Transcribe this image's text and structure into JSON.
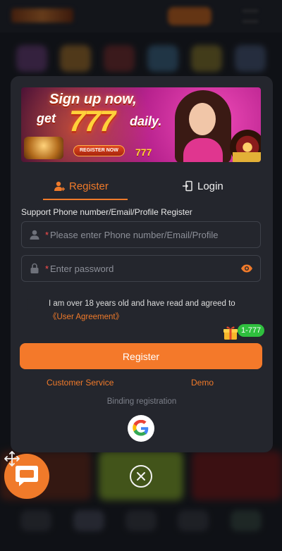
{
  "banner": {
    "line1": "Sign up now,",
    "line2_prefix": "get",
    "line2_number": "777",
    "line2_suffix": "daily.",
    "button": "REGISTER NOW",
    "slot": "777"
  },
  "tabs": {
    "register": "Register",
    "login": "Login",
    "active": "Register"
  },
  "form": {
    "support_text": "Support Phone number/Email/Profile Register",
    "required_mark": "*",
    "phone_placeholder": "Please enter Phone number/Email/Profile",
    "password_placeholder": "Enter password",
    "agree_text": "I am over 18 years old and have read and agreed to ",
    "agree_link": "《User Agreement》",
    "register_button": "Register"
  },
  "promo": {
    "tag": "1-777"
  },
  "links": {
    "customer_service": "Customer Service",
    "demo": "Demo",
    "binding": "Binding registration"
  },
  "colors": {
    "accent": "#f4792a",
    "modal_bg": "#24262d",
    "badge_green": "#2fbf3e"
  },
  "icons": {
    "register_tab": "add-user-icon",
    "login_tab": "login-door-icon",
    "phone_field": "user-icon",
    "password_field": "lock-icon",
    "password_toggle": "eye-icon",
    "social": "google-icon",
    "close": "close-circle-icon",
    "chat": "chat-bubble-icon",
    "drag": "move-icon",
    "gift": "gift-icon"
  }
}
